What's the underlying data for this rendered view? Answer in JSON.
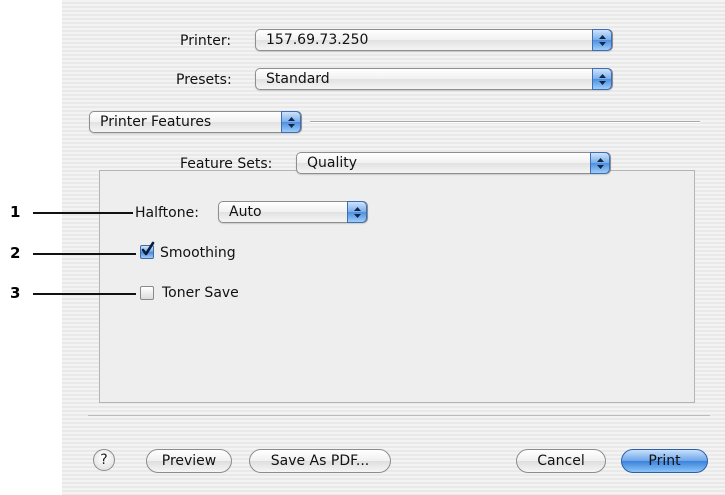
{
  "printer": {
    "label": "Printer:",
    "value": "157.69.73.250"
  },
  "presets": {
    "label": "Presets:",
    "value": "Standard"
  },
  "panel_selector": {
    "value": "Printer Features"
  },
  "feature_sets": {
    "label": "Feature Sets:",
    "value": "Quality"
  },
  "halftone": {
    "label": "Halftone:",
    "value": "Auto"
  },
  "smoothing": {
    "label": "Smoothing",
    "checked": true
  },
  "toner_save": {
    "label": "Toner Save",
    "checked": false
  },
  "callouts": [
    "1",
    "2",
    "3"
  ],
  "buttons": {
    "help": "?",
    "preview": "Preview",
    "save_pdf": "Save As PDF...",
    "cancel": "Cancel",
    "print": "Print"
  },
  "colors": {
    "accent": "#4d8fe0",
    "background": "#eeeeee"
  }
}
